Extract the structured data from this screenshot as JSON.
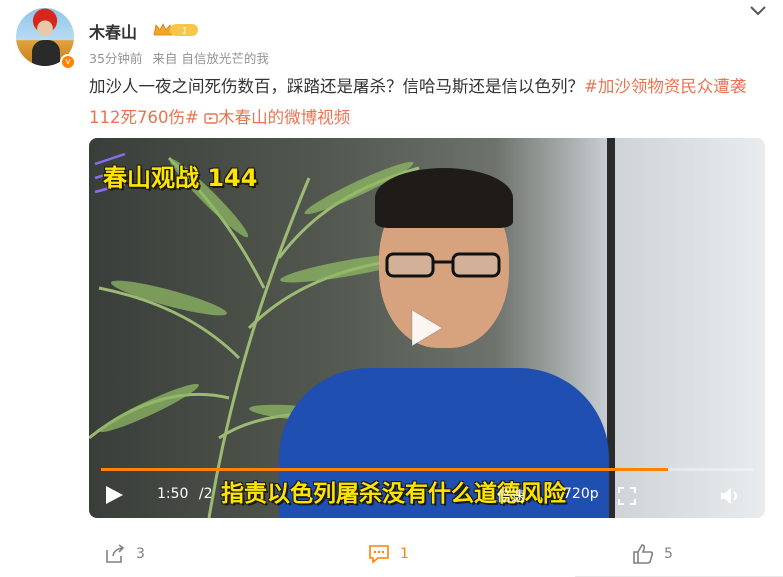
{
  "post": {
    "author": "木春山",
    "vip_level": "1",
    "time": "35分钟前",
    "source_prefix": "来自",
    "source": "自信放光芒的我",
    "text": "加沙人一夜之间死伤数百，踩踏还是屠杀？信哈马斯还是信以色列？",
    "hashtag": "#加沙领物资民众遭袭112死760伤#",
    "video_link": "木春山的微博视频"
  },
  "video": {
    "title": "春山观战 144",
    "subtitle": "指责以色列屠杀没有什么道德风险",
    "current_time": "1:50",
    "separator": "/",
    "total_time_partial": "2",
    "speed_label": "倍速",
    "quality_label": "720p",
    "progress_fraction": 0.87
  },
  "footer": {
    "share_count": "3",
    "comment_count": "1",
    "like_count": "5"
  },
  "colors": {
    "accent": "#eb7350",
    "brand_orange": "#ff8200",
    "subtitle_yellow": "#ffe400"
  },
  "icons": {
    "collapse": "chevron-down-icon",
    "play": "play-icon",
    "fullscreen": "fullscreen-icon",
    "volume": "volume-icon",
    "share": "share-icon",
    "comment": "comment-icon",
    "like": "thumbs-up-icon"
  }
}
